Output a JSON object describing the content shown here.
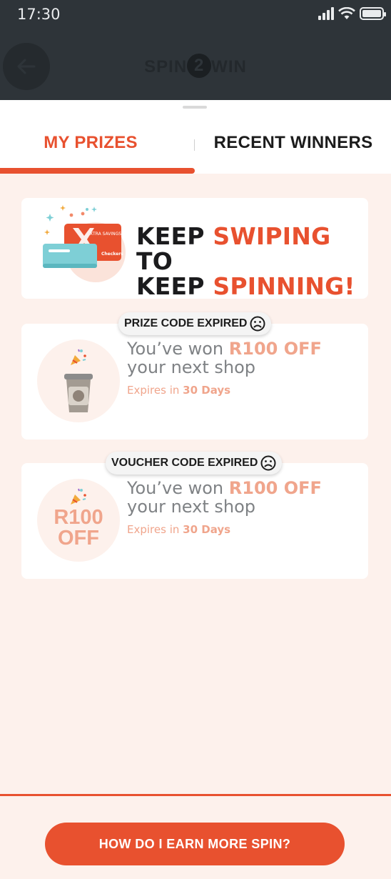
{
  "status_bar": {
    "time": "17:30"
  },
  "header": {
    "logo_left": "SPIN",
    "logo_mid": "2",
    "logo_right": "WIN"
  },
  "tabs": [
    {
      "label": "MY PRIZES",
      "active": true
    },
    {
      "label": "RECENT WINNERS",
      "active": false
    }
  ],
  "banner": {
    "card_brand": "XTRA SAVINGS",
    "card_store": "Checkers",
    "w1": "KEEP",
    "w2": "SWIPING",
    "w3": "TO",
    "w4": "KEEP",
    "w5": "SPINNING!"
  },
  "prizes": [
    {
      "badge": "PRIZE CODE EXPIRED",
      "won_prefix": "You’ve won",
      "amount": "R100 OFF",
      "suffix": "your next shop",
      "expires_prefix": "Expires in",
      "expires_days": "30 Days",
      "icon": "coffee-cup-icon"
    },
    {
      "badge": "VOUCHER CODE EXPIRED",
      "won_prefix": "You’ve won",
      "amount": "R100 OFF",
      "suffix": "your next shop",
      "expires_prefix": "Expires in",
      "expires_days": "30 Days",
      "icon_text_1": "R100",
      "icon_text_2": "OFF"
    }
  ],
  "cta": {
    "label": "HOW DO I EARN MORE SPIN?"
  },
  "colors": {
    "accent": "#e8512f",
    "muted_accent": "#f0a58c",
    "sheet_bg": "#fdf1ec"
  }
}
